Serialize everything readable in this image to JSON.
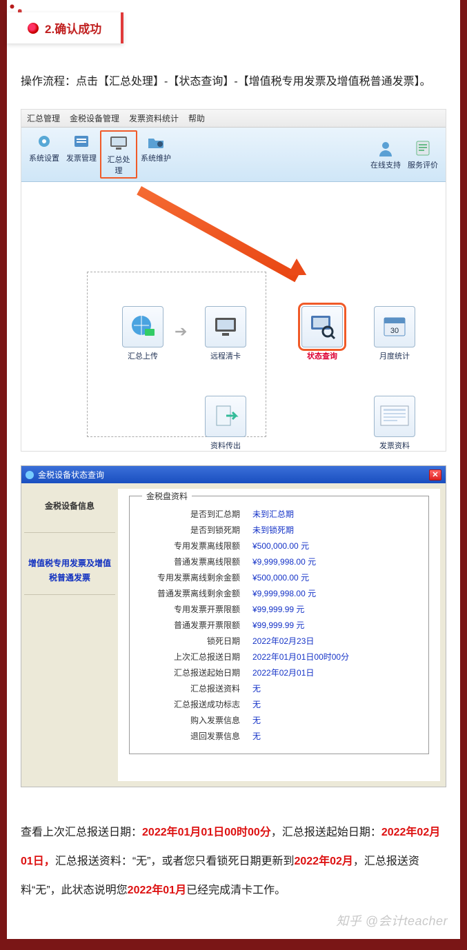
{
  "section": {
    "number": "2",
    "title": "确认成功"
  },
  "intro": "操作流程：点击【汇总处理】-【状态查询】-【增值税专用发票及增值税普通发票】。",
  "app1": {
    "menu": [
      "汇总管理",
      "金税设备管理",
      "发票资料统计",
      "帮助"
    ],
    "ribbon_left": [
      {
        "label": "系统设置",
        "icon": "gear"
      },
      {
        "label": "发票管理",
        "icon": "invoice"
      },
      {
        "label": "汇总处理",
        "icon": "monitor",
        "highlight": true
      },
      {
        "label": "系统维护",
        "icon": "folder"
      }
    ],
    "ribbon_right": [
      {
        "label": "在线支持",
        "icon": "person"
      },
      {
        "label": "服务评价",
        "icon": "clipboard"
      }
    ],
    "flow": {
      "upload": "汇总上传",
      "remote": "远程清卡",
      "status": "状态查询",
      "monthly": "月度统计",
      "export": "资料传出",
      "fpzl": "发票资料"
    }
  },
  "app2": {
    "title": "金税设备状态查询",
    "side_header": "金税设备信息",
    "side_selected": "增值税专用发票及增值税普通发票",
    "group_title": "金税盘资料",
    "rows": [
      {
        "k": "是否到汇总期",
        "v": "未到汇总期"
      },
      {
        "k": "是否到锁死期",
        "v": "未到锁死期"
      },
      {
        "k": "专用发票离线限额",
        "v": "¥500,000.00 元"
      },
      {
        "k": "普通发票离线限额",
        "v": "¥9,999,998.00 元"
      },
      {
        "k": "专用发票离线剩余金额",
        "v": "¥500,000.00 元"
      },
      {
        "k": "普通发票离线剩余金额",
        "v": "¥9,999,998.00 元"
      },
      {
        "k": "专用发票开票限额",
        "v": "¥99,999.99 元"
      },
      {
        "k": "普通发票开票限额",
        "v": "¥99,999.99 元"
      },
      {
        "k": "锁死日期",
        "v": "2022年02月23日"
      },
      {
        "k": "上次汇总报送日期",
        "v": "2022年01月01日00时00分"
      },
      {
        "k": "汇总报送起始日期",
        "v": "2022年02月01日"
      },
      {
        "k": "汇总报送资料",
        "v": "无"
      },
      {
        "k": "汇总报送成功标志",
        "v": "无"
      },
      {
        "k": "购入发票信息",
        "v": "无"
      },
      {
        "k": "退回发票信息",
        "v": "无"
      }
    ]
  },
  "final": {
    "p1": "查看上次汇总报送日期：",
    "d1": "2022年01月01日00时00分",
    "p2": "，汇总报送起始日期：",
    "d2": "2022年02月01日，",
    "p3": "汇总报送资料：“无”，或者您只看锁死日期更新到",
    "d3": "2022年02月",
    "p4": "，汇总报送资料“无”，此状态说明您",
    "d4": "2022年01月",
    "p5": "已经完成清卡工作。"
  },
  "watermark": "知乎 @会计teacher"
}
